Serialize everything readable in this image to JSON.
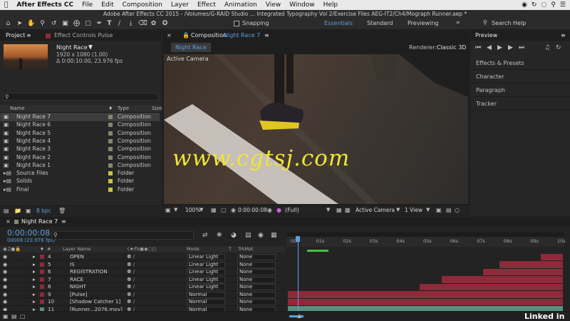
{
  "menubar": {
    "app": "After Effects CC",
    "items": [
      "File",
      "Edit",
      "Composition",
      "Layer",
      "Effect",
      "Animation",
      "View",
      "Window",
      "Help"
    ]
  },
  "window_title": "Adobe After Effects CC 2015 - /Volumes/G-RAID Studio ... Integrated Typography Vol 2/Exercise Files AEG-IT2/Ch4/Mograph Runner.aep *",
  "toolbar": {
    "snapping": "Snapping",
    "workspaces": [
      "Essentials",
      "Standard",
      "Previewing"
    ],
    "search": "Search Help"
  },
  "project": {
    "tab": "Project",
    "effect_tab": "Effect Controls Pulse",
    "item_name": "Night Race 7",
    "item_res": "1920 x 1080 (1.00)",
    "item_dur": "Δ 0:00:10:00, 23.976 fps",
    "col_name": "Name",
    "col_type": "Type",
    "col_size": "Size",
    "bpc": "8 bpc",
    "items": [
      {
        "name": "Night Race 7",
        "type": "Composition",
        "color": "#8a8570",
        "sel": true
      },
      {
        "name": "Night Race 6",
        "type": "Composition",
        "color": "#8a8570"
      },
      {
        "name": "Night Race 5",
        "type": "Composition",
        "color": "#8a8570"
      },
      {
        "name": "Night Race 4",
        "type": "Composition",
        "color": "#8a8570"
      },
      {
        "name": "Night Race 3",
        "type": "Composition",
        "color": "#8a8570"
      },
      {
        "name": "Night Race 2",
        "type": "Composition",
        "color": "#8a8570"
      },
      {
        "name": "Night Race 1",
        "type": "Composition",
        "color": "#8a8570"
      },
      {
        "name": "Source Files",
        "type": "Folder",
        "color": "#c8c24a"
      },
      {
        "name": "Solids",
        "type": "Folder",
        "color": "#c8c24a"
      },
      {
        "name": "Final",
        "type": "Folder",
        "color": "#c8c24a"
      }
    ]
  },
  "composition": {
    "header_label": "Composition",
    "header_name": "Night Race 7",
    "tab": "Night Race 7",
    "renderer_label": "Renderer:",
    "renderer_value": "Classic 3D",
    "camera_label": "Active Camera",
    "watermark": "www.cgtsj.com",
    "zoom": "100%",
    "timecode": "0:00:00:08",
    "resolution": "(Full)",
    "view_camera": "Active Camera",
    "view_count": "1 View"
  },
  "right_panels": {
    "preview": "Preview",
    "items": [
      "Effects & Presets",
      "Character",
      "Paragraph",
      "Tracker"
    ]
  },
  "timeline": {
    "tab": "Night Race 7",
    "timecode": "0:00:00:08",
    "frame_info": "00008 (23.976 fps)",
    "col_layer": "Layer Name",
    "col_mode": "Mode",
    "col_t": "T",
    "col_trkmat": "TrkMat",
    "ruler": [
      ":00f",
      "01s",
      "02s",
      "03s",
      "04s",
      "05s",
      "06s",
      "07s",
      "08s",
      "09s",
      "10s"
    ],
    "layers": [
      {
        "num": "4",
        "name": "OPEN",
        "mode": "Linear Light",
        "trk": "None",
        "color": "#8e2a3a"
      },
      {
        "num": "5",
        "name": "IS",
        "mode": "Linear Light",
        "trk": "None",
        "color": "#8e2a3a"
      },
      {
        "num": "6",
        "name": "REGISTRATION",
        "mode": "Linear Light",
        "trk": "None",
        "color": "#8e2a3a"
      },
      {
        "num": "7",
        "name": "RACE",
        "mode": "Linear Light",
        "trk": "None",
        "color": "#8e2a3a"
      },
      {
        "num": "8",
        "name": "NIGHT",
        "mode": "Linear Light",
        "trk": "None",
        "color": "#8e2a3a"
      },
      {
        "num": "9",
        "name": "[Pulse]",
        "mode": "Normal",
        "trk": "None",
        "color": "#8e2a3a"
      },
      {
        "num": "10",
        "name": "[Shadow Catcher 1]",
        "mode": "Normal",
        "trk": "None",
        "color": "#8e2a3a"
      },
      {
        "num": "11",
        "name": "[Runner...2076.mov]",
        "mode": "Normal",
        "trk": "None",
        "color": "#5b8f7d"
      }
    ]
  },
  "brand": "Linked in"
}
